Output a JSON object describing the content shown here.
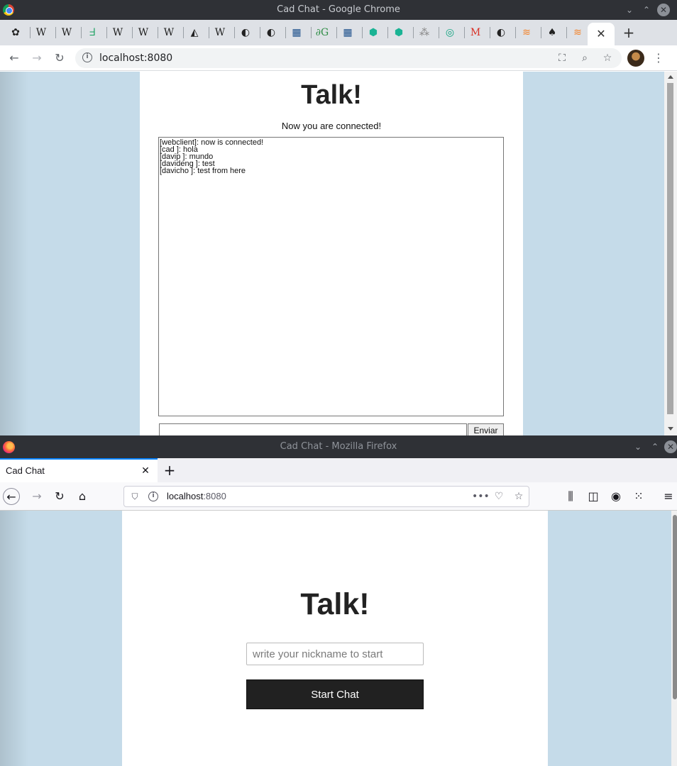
{
  "chrome": {
    "window_title": "Cad Chat - Google Chrome",
    "minimize": "⌄",
    "maximize": "⌃",
    "close": "✕",
    "tab_close": "✕",
    "new_tab": "+",
    "url": "localhost:8080",
    "tabs": [
      {
        "icon": "puzzle-icon",
        "glyph": "✿"
      },
      {
        "icon": "wikipedia-icon",
        "glyph": "W"
      },
      {
        "icon": "wikipedia-icon",
        "glyph": "W"
      },
      {
        "icon": "project-icon",
        "glyph": "ᖵ"
      },
      {
        "icon": "wikipedia-icon",
        "glyph": "W"
      },
      {
        "icon": "wikipedia-icon",
        "glyph": "W"
      },
      {
        "icon": "wikipedia-icon",
        "glyph": "W"
      },
      {
        "icon": "cursor-icon",
        "glyph": "◭"
      },
      {
        "icon": "wikipedia-icon",
        "glyph": "W"
      },
      {
        "icon": "globe-icon",
        "glyph": "◐"
      },
      {
        "icon": "globe-icon",
        "glyph": "◐"
      },
      {
        "icon": "grid-icon",
        "glyph": "▦"
      },
      {
        "icon": "geeks-icon",
        "glyph": "∂G"
      },
      {
        "icon": "grid-icon",
        "glyph": "▦"
      },
      {
        "icon": "cube-icon",
        "glyph": "⬢"
      },
      {
        "icon": "cube-icon",
        "glyph": "⬢"
      },
      {
        "icon": "dots-icon",
        "glyph": "⁂"
      },
      {
        "icon": "openai-icon",
        "glyph": "◎"
      },
      {
        "icon": "gmail-icon",
        "glyph": "M"
      },
      {
        "icon": "globe-icon",
        "glyph": "◐"
      },
      {
        "icon": "stackoverflow-icon",
        "glyph": "≋"
      },
      {
        "icon": "spade-icon",
        "glyph": "♠"
      },
      {
        "icon": "stackoverflow-icon",
        "glyph": "≋"
      }
    ],
    "page": {
      "title": "Talk!",
      "status": "Now you are connected!",
      "messages": [
        "[webclient]: now is connected!",
        "[cad ]: hola",
        "[davip ]: mundo",
        "[davideng ]: test",
        "[davicho ]: test from here"
      ],
      "send_label": "Enviar"
    }
  },
  "firefox": {
    "window_title": "Cad Chat - Mozilla Firefox",
    "minimize": "⌄",
    "maximize": "⌃",
    "close": "✕",
    "tab_label": "Cad Chat",
    "tab_close": "✕",
    "new_tab": "+",
    "url_host": "localhost",
    "url_port": ":8080",
    "page": {
      "title": "Talk!",
      "nickname_placeholder": "write your nickname to start",
      "start_label": "Start Chat"
    }
  },
  "colors": {
    "page_background": "#c5dbe9",
    "button_dark": "#212121"
  }
}
